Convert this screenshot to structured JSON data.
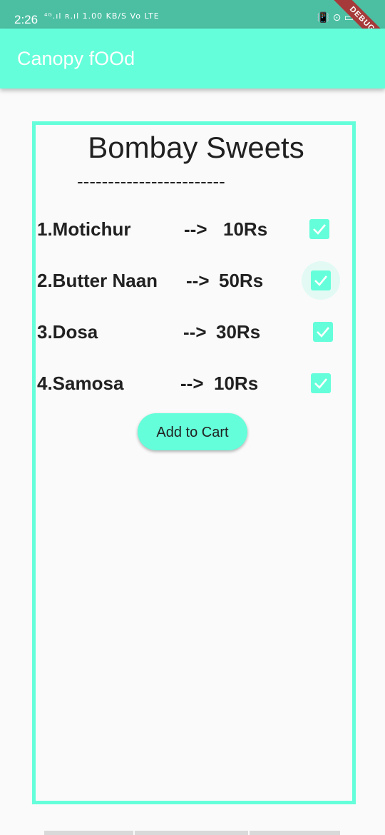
{
  "status_bar": {
    "time": "2:26",
    "left_indicators": "⁴ᴳ.ıl ʀ.ıl 1.00 KB/S Vo LTE",
    "right_indicators": "📳 ⊙ ▭",
    "debug_label": "DEBUG"
  },
  "app_bar": {
    "title": "Canopy fOOd",
    "color": "#64ffda"
  },
  "shop": {
    "title": "Bombay Sweets",
    "divider": "------------------------"
  },
  "menu": {
    "items": [
      {
        "name": "1.Motichur",
        "arrow": "-->",
        "price": "10Rs",
        "checked": true
      },
      {
        "name": "2.Butter Naan",
        "arrow": "-->",
        "price": "50Rs",
        "checked": true
      },
      {
        "name": "3.Dosa",
        "arrow": "-->",
        "price": "30Rs",
        "checked": true
      },
      {
        "name": "4.Samosa",
        "arrow": "-->",
        "price": "10Rs",
        "checked": true
      }
    ]
  },
  "actions": {
    "add_to_cart_label": "Add to Cart"
  },
  "colors": {
    "accent": "#64ffda",
    "status_bar": "#4cbfa3",
    "background": "#fafafa",
    "debug_banner": "#a63a3a"
  }
}
